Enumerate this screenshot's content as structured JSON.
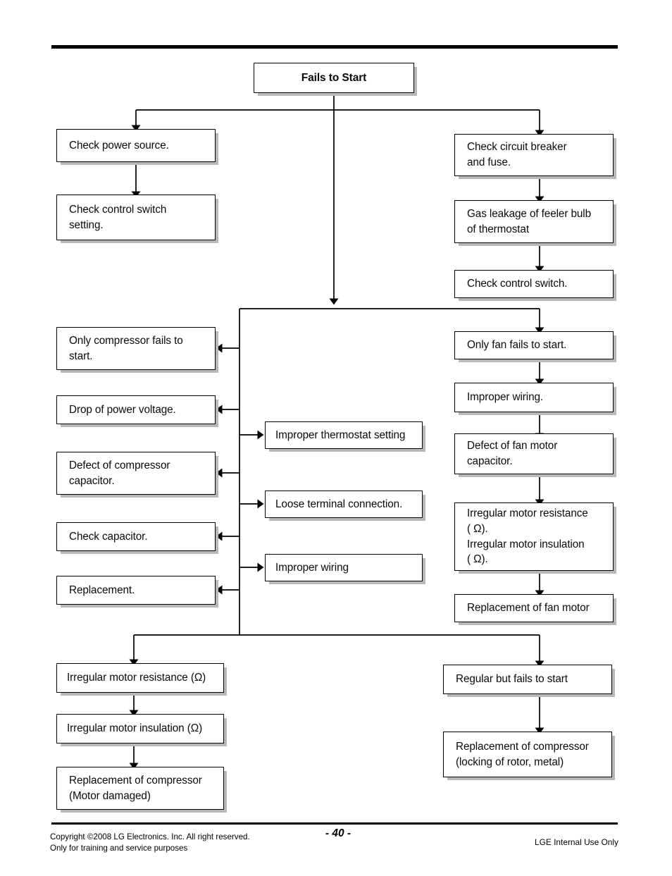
{
  "document": {
    "title": "Fails to Start troubleshooting flowchart",
    "page_number": "- 40 -",
    "footer_copyright": "Copyright ©2008 LG Electronics. Inc. All right reserved.\nOnly for training and service purposes",
    "footer_notice": "LGE Internal Use Only"
  },
  "colors": {
    "line": "#000000",
    "box_fill": "#ffffff",
    "box_border": "#000000",
    "shadow": "#b8b8b8",
    "text": "#0a0a0a"
  },
  "chart_data": {
    "type": "diagram",
    "title": "Fails to Start",
    "nodes": [
      {
        "id": "start",
        "text": "Fails to Start"
      },
      {
        "id": "check-power",
        "text": "Check  power source."
      },
      {
        "id": "check-ctrl-set",
        "text": "Check control switch\nsetting."
      },
      {
        "id": "check-breaker",
        "text": "Check circuit breaker\nand fuse."
      },
      {
        "id": "gas-leakage",
        "text": "Gas leakage of feeler bulb\nof thermostat"
      },
      {
        "id": "check-ctrl-switch",
        "text": "Check control switch."
      },
      {
        "id": "only-comp-fails",
        "text": "Only compressor fails to\nstart."
      },
      {
        "id": "drop-voltage",
        "text": "Drop of power voltage."
      },
      {
        "id": "defect-comp-cap",
        "text": "Defect of compressor\ncapacitor."
      },
      {
        "id": "check-capacitor",
        "text": " Check capacitor."
      },
      {
        "id": "replacement",
        "text": "Replacement."
      },
      {
        "id": "improper-thermostat",
        "text": "Improper thermostat setting"
      },
      {
        "id": "loose-terminal",
        "text": "Loose terminal connection."
      },
      {
        "id": "improper-wiring-mid",
        "text": "Improper wiring"
      },
      {
        "id": "only-fan-fails",
        "text": "Only fan fails to start."
      },
      {
        "id": "improper-wiring-r",
        "text": "Improper wiring."
      },
      {
        "id": "defect-fan-cap",
        "text": "Defect of fan motor\ncapacitor."
      },
      {
        "id": "irregular-fan-motor",
        "text": "Irregular motor resistance\n( Ω).\nIrregular motor insulation\n( Ω)."
      },
      {
        "id": "replace-fan-motor",
        "text": "Replacement of fan motor"
      },
      {
        "id": "irr-res-bl",
        "text": "Irregular motor resistance (Ω)"
      },
      {
        "id": "irr-ins-bl",
        "text": "Irregular motor insulation (Ω)"
      },
      {
        "id": "replace-comp-motor",
        "text": "Replacement of compressor\n(Motor damaged)"
      },
      {
        "id": "regular-fails",
        "text": "Regular but fails to start"
      },
      {
        "id": "replace-comp-rotor",
        "text": "Replacement of compressor\n(locking of rotor, metal)"
      }
    ],
    "edges": [
      {
        "from": "start",
        "to": "check-power"
      },
      {
        "from": "start",
        "to": "check-breaker"
      },
      {
        "from": "start",
        "to": "branch-bus-1"
      },
      {
        "from": "check-power",
        "to": "check-ctrl-set"
      },
      {
        "from": "check-breaker",
        "to": "gas-leakage"
      },
      {
        "from": "gas-leakage",
        "to": "check-ctrl-switch"
      },
      {
        "from": "branch-bus-1",
        "to": "only-fan-fails"
      },
      {
        "from": "branch-bus-1",
        "to": "only-comp-fails"
      },
      {
        "from": "spine",
        "to": "drop-voltage"
      },
      {
        "from": "spine",
        "to": "defect-comp-cap"
      },
      {
        "from": "spine",
        "to": "check-capacitor"
      },
      {
        "from": "spine",
        "to": "replacement"
      },
      {
        "from": "spine",
        "to": "improper-thermostat"
      },
      {
        "from": "spine",
        "to": "loose-terminal"
      },
      {
        "from": "spine",
        "to": "improper-wiring-mid"
      },
      {
        "from": "only-fan-fails",
        "to": "improper-wiring-r"
      },
      {
        "from": "improper-wiring-r",
        "to": "defect-fan-cap"
      },
      {
        "from": "defect-fan-cap",
        "to": "irregular-fan-motor"
      },
      {
        "from": "irregular-fan-motor",
        "to": "replace-fan-motor"
      },
      {
        "from": "spine",
        "to": "branch-bus-2"
      },
      {
        "from": "branch-bus-2",
        "to": "irr-res-bl"
      },
      {
        "from": "branch-bus-2",
        "to": "regular-fails"
      },
      {
        "from": "irr-res-bl",
        "to": "irr-ins-bl"
      },
      {
        "from": "irr-ins-bl",
        "to": "replace-comp-motor"
      },
      {
        "from": "regular-fails",
        "to": "replace-comp-rotor"
      }
    ]
  }
}
